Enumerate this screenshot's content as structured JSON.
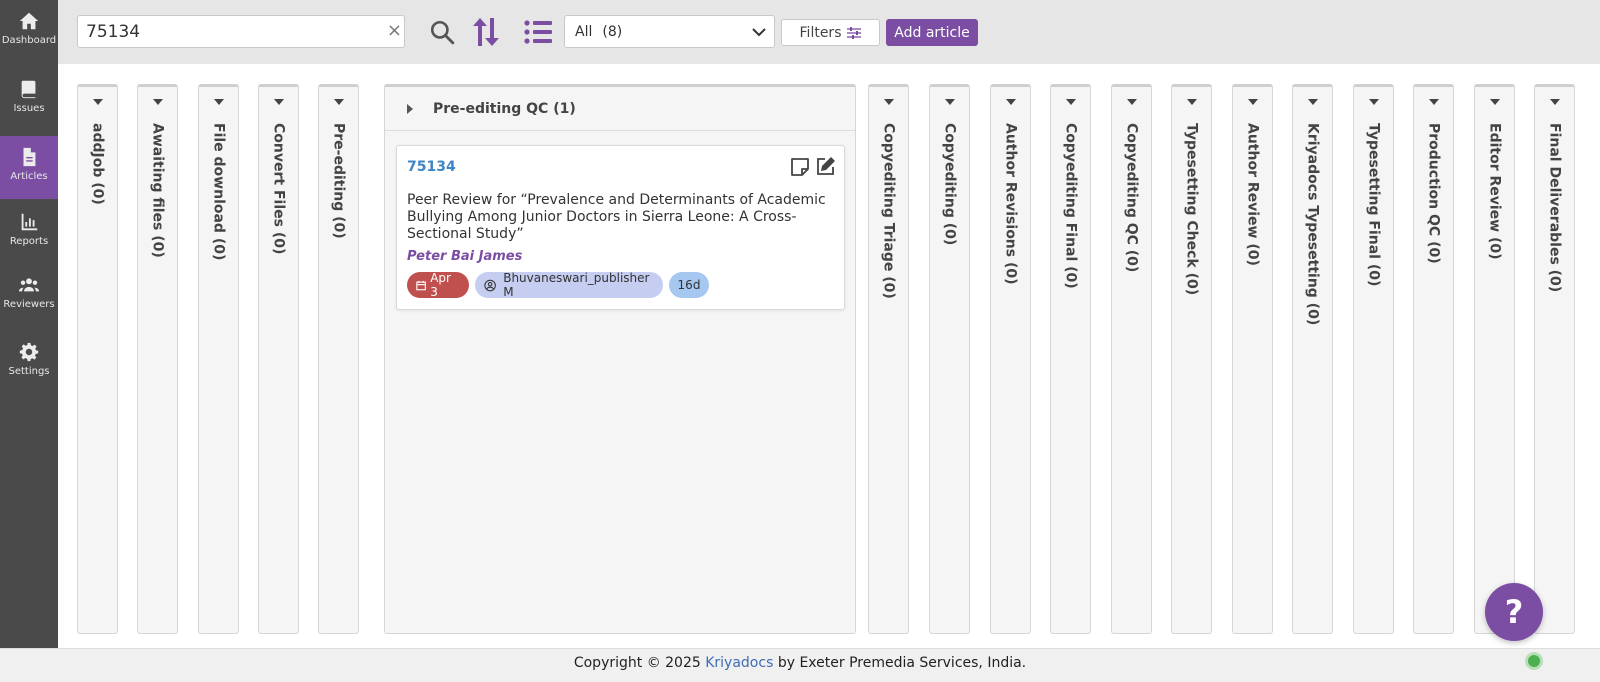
{
  "sidebar": {
    "items": [
      {
        "label": "Dashboard",
        "icon": "home-icon"
      },
      {
        "label": "Issues",
        "icon": "book-icon"
      },
      {
        "label": "Articles",
        "icon": "document-icon",
        "active": true
      },
      {
        "label": "Reports",
        "icon": "chart-icon"
      },
      {
        "label": "Reviewers",
        "icon": "users-icon"
      },
      {
        "label": "Settings",
        "icon": "gear-icon"
      }
    ]
  },
  "toolbar": {
    "search_value": "75134",
    "clear_glyph": "×",
    "filter_select": {
      "label": "All",
      "count": "(8)"
    },
    "filters_label": "Filters",
    "add_label": "Add article"
  },
  "board": {
    "columns_left": [
      "addJob (0)",
      "Awaiting files (0)",
      "File download (0)",
      "Convert Files (0)",
      "Pre-editing (0)"
    ],
    "open_column": {
      "title": "Pre-editing QC (1)",
      "card": {
        "id": "75134",
        "title": "Peer Review for “Prevalence and Determinants of Academic Bullying Among Junior Doctors in Sierra Leone: A Cross-Sectional Study”",
        "author": "Peter Bai James",
        "date_tag": "Apr 3",
        "assignee_tag": "Bhuvaneswari_publisher M",
        "age_tag": "16d"
      }
    },
    "columns_right": [
      "Copyediting Triage (0)",
      "Copyediting (0)",
      "Author Revisions (0)",
      "Copyediting Final (0)",
      "Copyediting QC (0)",
      "Typesetting Check (0)",
      "Author Review (0)",
      "Kriyadocs Typesetting (0)",
      "Typesetting Final (0)",
      "Production QC (0)",
      "Editor Review (0)",
      "Final Deliverables (0)"
    ]
  },
  "help_glyph": "?",
  "footer": {
    "prefix": "Copyright © 2025",
    "brand": "Kriyadocs",
    "suffix": "by Exeter Premedia Services, India."
  },
  "colors": {
    "accent": "#7b4ea3",
    "sidebar_bg": "#4a4a4a",
    "link": "#3d85c6",
    "date_tag": "#c0504d",
    "assignee_tag": "#c5cdf0",
    "age_tag": "#a6c8f0"
  }
}
